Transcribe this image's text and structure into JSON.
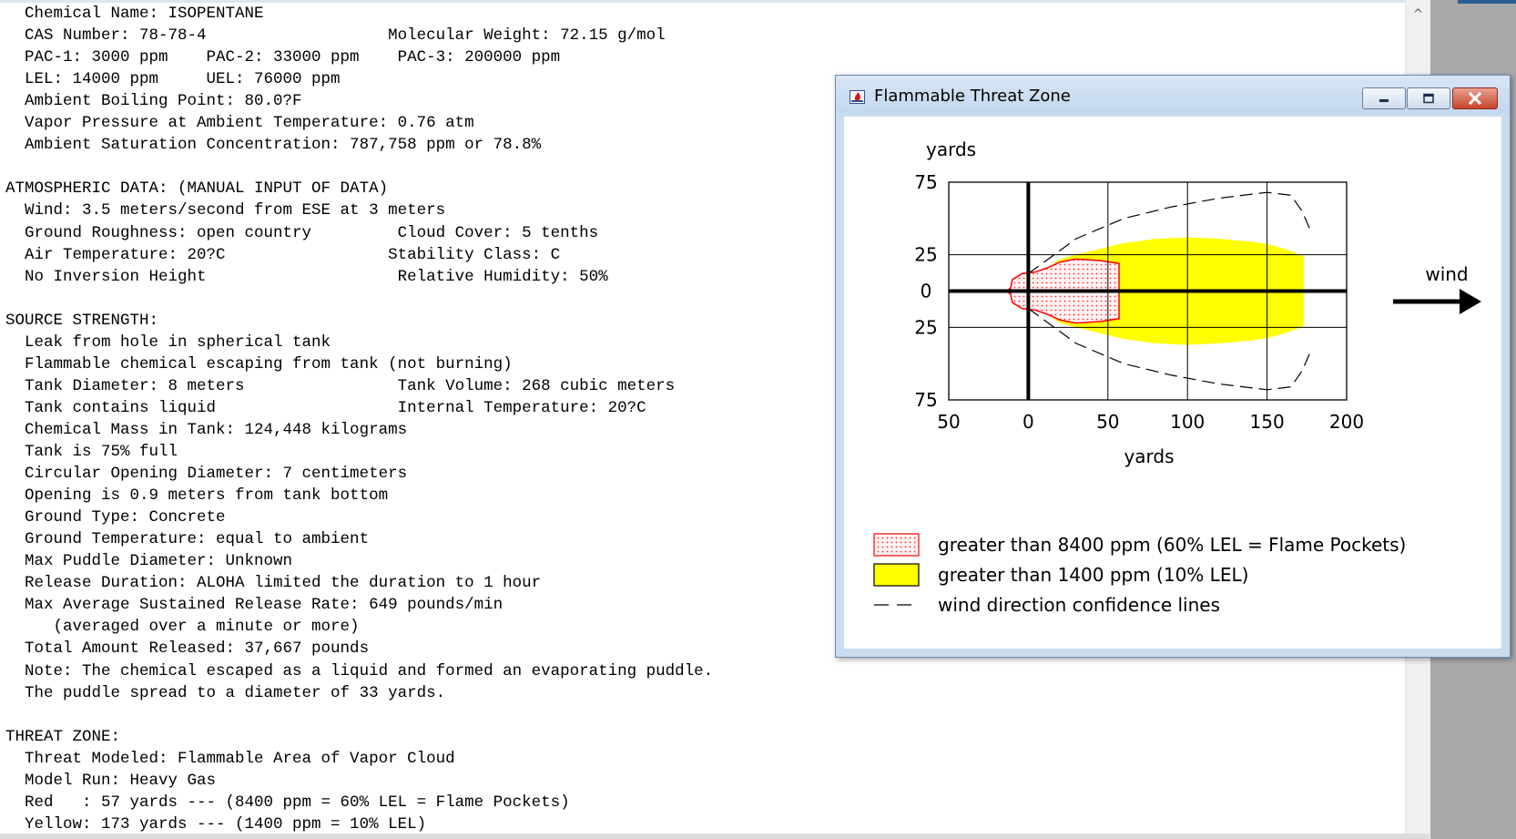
{
  "report_lines": [
    "  Chemical Name: ISOPENTANE",
    "  CAS Number: 78-78-4                   Molecular Weight: 72.15 g/mol",
    "  PAC-1: 3000 ppm    PAC-2: 33000 ppm    PAC-3: 200000 ppm",
    "  LEL: 14000 ppm     UEL: 76000 ppm",
    "  Ambient Boiling Point: 80.0?F",
    "  Vapor Pressure at Ambient Temperature: 0.76 atm",
    "  Ambient Saturation Concentration: 787,758 ppm or 78.8%",
    "",
    "ATMOSPHERIC DATA: (MANUAL INPUT OF DATA)",
    "  Wind: 3.5 meters/second from ESE at 3 meters",
    "  Ground Roughness: open country         Cloud Cover: 5 tenths",
    "  Air Temperature: 20?C                 Stability Class: C",
    "  No Inversion Height                    Relative Humidity: 50%",
    "",
    "SOURCE STRENGTH:",
    "  Leak from hole in spherical tank",
    "  Flammable chemical escaping from tank (not burning)",
    "  Tank Diameter: 8 meters                Tank Volume: 268 cubic meters",
    "  Tank contains liquid                   Internal Temperature: 20?C",
    "  Chemical Mass in Tank: 124,448 kilograms",
    "  Tank is 75% full",
    "  Circular Opening Diameter: 7 centimeters",
    "  Opening is 0.9 meters from tank bottom",
    "  Ground Type: Concrete",
    "  Ground Temperature: equal to ambient",
    "  Max Puddle Diameter: Unknown",
    "  Release Duration: ALOHA limited the duration to 1 hour",
    "  Max Average Sustained Release Rate: 649 pounds/min",
    "     (averaged over a minute or more)",
    "  Total Amount Released: 37,667 pounds",
    "  Note: The chemical escaped as a liquid and formed an evaporating puddle.",
    "  The puddle spread to a diameter of 33 yards.",
    "",
    "THREAT ZONE:",
    "  Threat Modeled: Flammable Area of Vapor Cloud",
    "  Model Run: Heavy Gas",
    "  Red   : 57 yards --- (8400 ppm = 60% LEL = Flame Pockets)",
    "  Yellow: 173 yards --- (1400 ppm = 10% LEL)"
  ],
  "scrollbar": {
    "up_glyph": "^"
  },
  "window": {
    "title": "Flammable Threat Zone",
    "controls": {
      "minimize_icon": "minimize-icon",
      "maximize_icon": "maximize-icon",
      "close_icon": "close-icon"
    }
  },
  "chart_data": {
    "type": "area",
    "xlabel": "yards",
    "ylabel": "yards",
    "xlim": [
      -50,
      200
    ],
    "ylim": [
      -75,
      75
    ],
    "x_ticks": [
      -50,
      0,
      50,
      100,
      150,
      200
    ],
    "x_tick_labels": [
      "50",
      "0",
      "50",
      "100",
      "150",
      "200"
    ],
    "y_ticks": [
      75,
      25,
      0,
      -25,
      -75
    ],
    "y_tick_labels": [
      "75",
      "25",
      "0",
      "25",
      "75"
    ],
    "grid": true,
    "wind_label": "wind",
    "legend": [
      {
        "name": "greater than 8400 ppm (60% LEL = Flame Pockets)",
        "style": "red-dotted-fill"
      },
      {
        "name": "greater than 1400 ppm (10% LEL)",
        "style": "yellow-fill"
      },
      {
        "name": "wind direction confidence lines",
        "style": "dashed-line"
      }
    ],
    "series": [
      {
        "name": "greater than 8400 ppm (60% LEL = Flame Pockets)",
        "color": "#ff0000",
        "fill": "#ffd6d6",
        "outline": [
          [
            -12,
            -2
          ],
          [
            -10,
            8
          ],
          [
            -4,
            12
          ],
          [
            4,
            13
          ],
          [
            12,
            16
          ],
          [
            20,
            20
          ],
          [
            30,
            22
          ],
          [
            45,
            21
          ],
          [
            57,
            19
          ],
          [
            57,
            -19
          ],
          [
            45,
            -21
          ],
          [
            30,
            -22
          ],
          [
            20,
            -20
          ],
          [
            12,
            -16
          ],
          [
            4,
            -13
          ],
          [
            -4,
            -12
          ],
          [
            -10,
            -8
          ],
          [
            -12,
            2
          ]
        ]
      },
      {
        "name": "greater than 1400 ppm (10% LEL)",
        "color": "#ffff00",
        "fill": "#ffff00",
        "outline": [
          [
            4,
            13
          ],
          [
            12,
            16
          ],
          [
            20,
            22
          ],
          [
            30,
            25
          ],
          [
            45,
            29
          ],
          [
            60,
            33
          ],
          [
            80,
            36
          ],
          [
            100,
            37
          ],
          [
            120,
            36
          ],
          [
            140,
            34
          ],
          [
            152,
            32
          ],
          [
            164,
            28
          ],
          [
            173,
            24
          ],
          [
            173,
            -24
          ],
          [
            164,
            -28
          ],
          [
            152,
            -32
          ],
          [
            140,
            -34
          ],
          [
            120,
            -36
          ],
          [
            100,
            -37
          ],
          [
            80,
            -36
          ],
          [
            60,
            -33
          ],
          [
            45,
            -29
          ],
          [
            30,
            -25
          ],
          [
            20,
            -22
          ],
          [
            12,
            -16
          ],
          [
            4,
            -13
          ]
        ]
      },
      {
        "name": "wind direction confidence lines",
        "color": "#000000",
        "upper": [
          [
            0,
            12
          ],
          [
            10,
            20
          ],
          [
            30,
            36
          ],
          [
            60,
            50
          ],
          [
            90,
            58
          ],
          [
            120,
            64
          ],
          [
            150,
            68
          ],
          [
            165,
            66
          ],
          [
            172,
            55
          ],
          [
            178,
            40
          ]
        ],
        "lower": [
          [
            0,
            -12
          ],
          [
            10,
            -20
          ],
          [
            30,
            -36
          ],
          [
            60,
            -50
          ],
          [
            90,
            -58
          ],
          [
            120,
            -64
          ],
          [
            150,
            -68
          ],
          [
            165,
            -66
          ],
          [
            172,
            -55
          ],
          [
            178,
            -40
          ]
        ]
      }
    ]
  }
}
